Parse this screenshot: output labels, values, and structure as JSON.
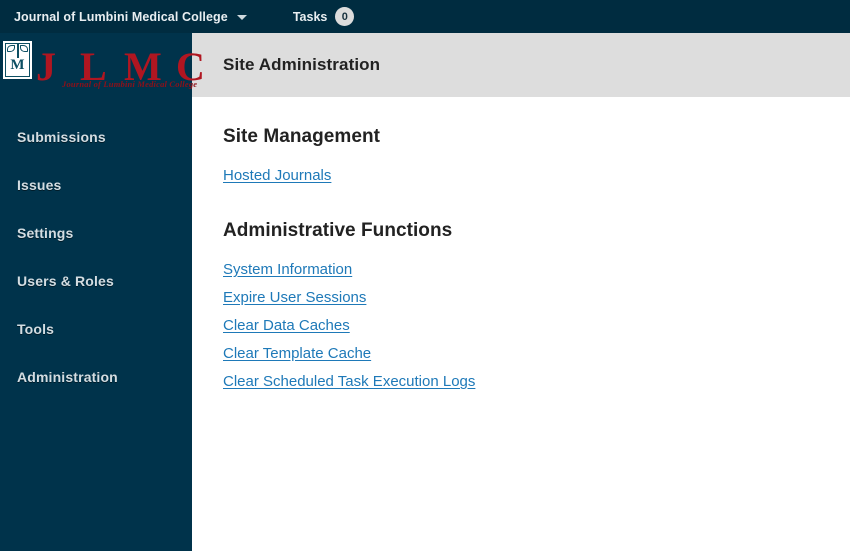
{
  "topbar": {
    "journal_title": "Journal of Lumbini Medical College",
    "dropdown_icon": "chevron-down-icon",
    "tasks_label": "Tasks",
    "tasks_count": "0"
  },
  "brand": {
    "emblem_icon": "caduceus-shield-icon",
    "monogram": "M",
    "letters": [
      "J",
      "L",
      "M",
      "C"
    ],
    "tagline": "Journal of Lumbini Medical College",
    "letter_color": "#b01621",
    "tagline_color": "#8e1019"
  },
  "sidebar": {
    "background": "#00334b",
    "items": [
      {
        "label": "Submissions"
      },
      {
        "label": "Issues"
      },
      {
        "label": "Settings"
      },
      {
        "label": "Users & Roles"
      },
      {
        "label": "Tools"
      },
      {
        "label": "Administration"
      }
    ]
  },
  "page_header": {
    "title": "Site Administration",
    "background": "#dddddd"
  },
  "main": {
    "site_management": {
      "heading": "Site Management",
      "links": [
        {
          "label": "Hosted Journals"
        }
      ]
    },
    "administrative_functions": {
      "heading": "Administrative Functions",
      "links": [
        {
          "label": "System Information"
        },
        {
          "label": "Expire User Sessions"
        },
        {
          "label": "Clear Data Caches"
        },
        {
          "label": "Clear Template Cache"
        },
        {
          "label": "Clear Scheduled Task Execution Logs"
        }
      ]
    }
  },
  "colors": {
    "topbar": "#002c40",
    "sidebar": "#00334b",
    "link": "#1e79b8",
    "header_strip": "#dddddd"
  }
}
